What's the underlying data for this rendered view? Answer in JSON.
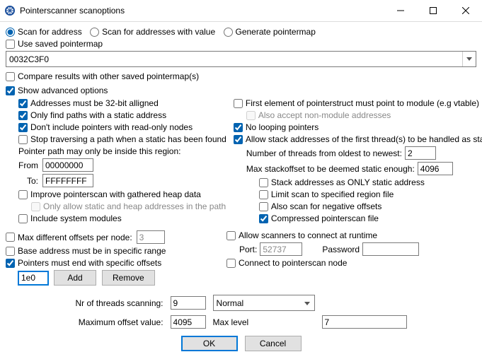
{
  "window": {
    "title": "Pointerscanner scanoptions"
  },
  "scan_mode": {
    "for_address": "Scan for address",
    "for_addresses_with_value": "Scan for addresses with value",
    "generate_pointermap": "Generate pointermap"
  },
  "use_saved_pointermap": "Use saved pointermap",
  "address_value": "0032C3F0",
  "compare_results": "Compare results with other saved pointermap(s)",
  "show_advanced": "Show advanced options",
  "left": {
    "aligned32": "Addresses must be 32-bit alligned",
    "static_only": "Only find paths with a static address",
    "no_readonly": "Don't include pointers with read-only nodes",
    "stop_on_static": "Stop traversing a path when a static has been found",
    "region_header": "Pointer path may only be inside this region:",
    "from_lbl": "From",
    "from_val": "00000000",
    "to_lbl": "To:",
    "to_val": "FFFFFFFF",
    "improve_heap": "Improve pointerscan with gathered heap data",
    "only_static_heap": "Only allow static and heap addresses in the path",
    "include_sys": "Include system modules"
  },
  "right": {
    "first_elem_module": "First element of pointerstruct must point to module (e.g vtable)",
    "also_nonmodule": "Also accept non-module addresses",
    "no_looping": "No looping pointers",
    "allow_stack": "Allow stack addresses of the first thread(s) to be handled as static",
    "threads_lbl": "Number of threads from oldest to newest:",
    "threads_val": "2",
    "stackoffset_lbl": "Max stackoffset to be deemed static enough:",
    "stackoffset_val": "4096",
    "stack_only_static": "Stack addresses as ONLY static address",
    "limit_region_file": "Limit scan to specified region file",
    "also_negative": "Also scan for negative offsets",
    "compressed": "Compressed pointerscan file"
  },
  "mid_left": {
    "max_diff_lbl": "Max different offsets per node:",
    "max_diff_val": "3",
    "base_in_range": "Base address must be in specific range",
    "end_specific": "Pointers must end with specific offsets",
    "offset_val": "1e0",
    "add_btn": "Add",
    "remove_btn": "Remove"
  },
  "mid_right": {
    "allow_connect": "Allow scanners to connect at runtime",
    "port_lbl": "Port:",
    "port_val": "52737",
    "password_lbl": "Password",
    "connect_node": "Connect to pointerscan node"
  },
  "bottom": {
    "threads_lbl": "Nr of threads scanning:",
    "threads_val": "9",
    "priority": "Normal",
    "maxoffset_lbl": "Maximum offset value:",
    "maxoffset_val": "4095",
    "maxlevel_lbl": "Max level",
    "maxlevel_val": "7",
    "ok": "OK",
    "cancel": "Cancel"
  }
}
